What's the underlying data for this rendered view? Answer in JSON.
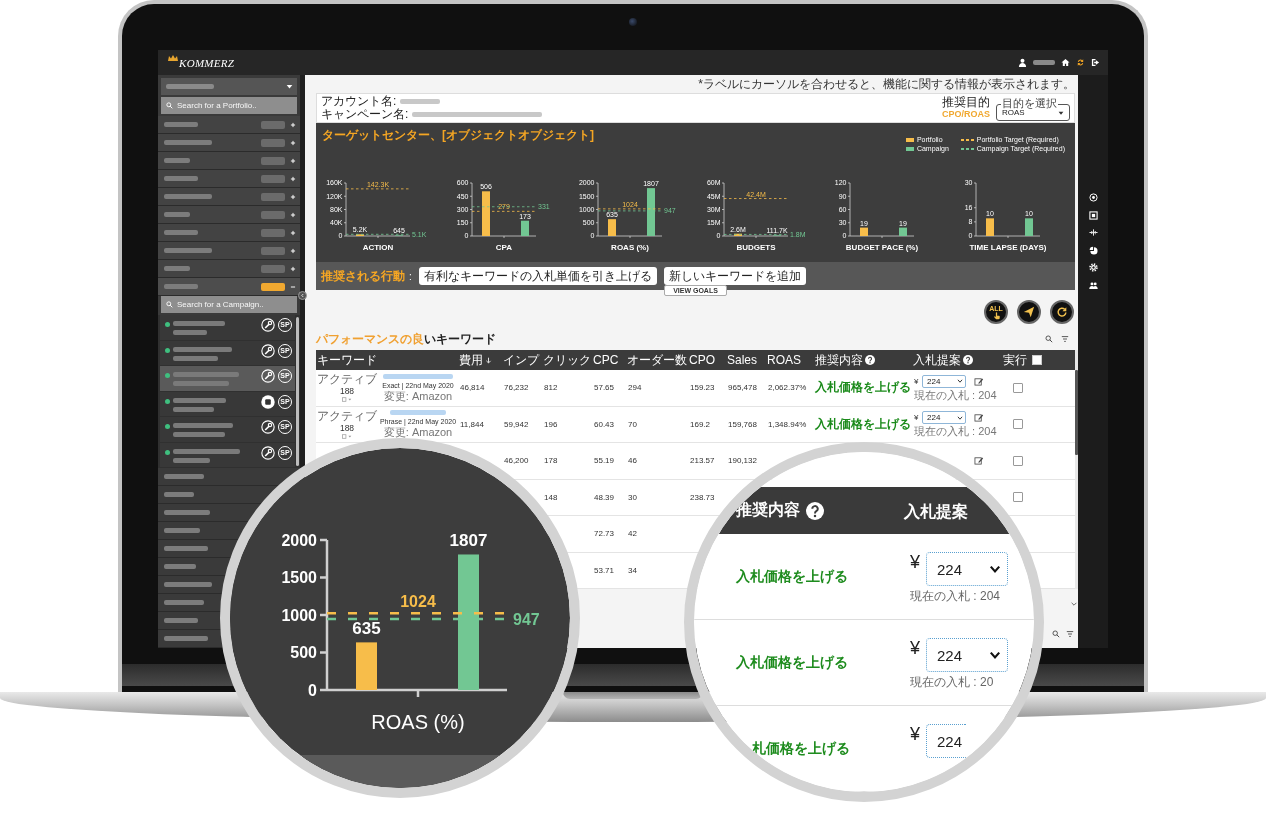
{
  "topbar": {
    "logo": "KOMMERZ"
  },
  "sidebar": {
    "portfolio_search": {
      "placeholder": "Search for a Portfolio.."
    },
    "portfolios": [
      {
        "expanded": false
      },
      {
        "expanded": false
      },
      {
        "expanded": false
      },
      {
        "expanded": false
      },
      {
        "expanded": false
      },
      {
        "expanded": false
      },
      {
        "expanded": false
      },
      {
        "expanded": false
      },
      {
        "expanded": false
      },
      {
        "expanded": true,
        "campaign_search": {
          "placeholder": "Search for a Campaign.."
        },
        "campaigns": [
          {
            "selected": false,
            "kind": "wrench",
            "type": "SP",
            "color": "#3fbf7f"
          },
          {
            "selected": false,
            "kind": "wrench",
            "type": "SP",
            "color": "#3fbf7f"
          },
          {
            "selected": true,
            "kind": "wrench",
            "type": "SP",
            "color": "#3fbf7f"
          },
          {
            "selected": false,
            "kind": "disc",
            "type": "SP",
            "color": "#3fbf7f"
          },
          {
            "selected": false,
            "kind": "wrench",
            "type": "SP",
            "color": "#3fbf7f"
          },
          {
            "selected": false,
            "kind": "wrench",
            "type": "SP",
            "color": "#3fbf7f"
          }
        ]
      }
    ]
  },
  "hint": "*ラベルにカーソルを合わせると、機能に関する情報が表示されます。",
  "account": {
    "account_label": "アカウント名:",
    "campaign_label": "キャンペーン名:",
    "goal_label": "推奨目的",
    "goal_value": "CPO/ROAS",
    "goal_select": {
      "legend": "目的を選択",
      "value": "ROAS"
    }
  },
  "target_panel": {
    "title": "ターゲットセンター、[オブジェクトオブジェクト]",
    "legend": [
      {
        "label": "Portfolio",
        "kind": "bar",
        "color": "#f7bd4a"
      },
      {
        "label": "Campaign",
        "kind": "bar",
        "color": "#72c793"
      },
      {
        "label": "Portfolio Target (Required)",
        "kind": "dash",
        "color": "#f7bd4a"
      },
      {
        "label": "Campaign Target (Required)",
        "kind": "dash",
        "color": "#72c793"
      }
    ],
    "charts": [
      {
        "chart_data": {
          "type": "bar",
          "xlabel": "ACTION",
          "series": [
            {
              "color": "#f7bd4a",
              "values": [
                5200
              ]
            },
            {
              "color": "#72c793",
              "values": [
                645
              ]
            }
          ],
          "ylim": [
            0,
            160000
          ],
          "yticks": [
            {
              "value": 0,
              "label": "0"
            },
            {
              "value": 40000,
              "label": "40K"
            },
            {
              "value": 80000,
              "label": "80K"
            },
            {
              "value": 120000,
              "label": "120K"
            },
            {
              "value": 160000,
              "label": "160K"
            }
          ],
          "value_labels": [
            "5.2K",
            "645"
          ],
          "ref_lines": [
            {
              "axis": "y",
              "value": 142300,
              "label": "142.3K",
              "color": "#f7bd4a"
            },
            {
              "axis": "y",
              "value": 5100,
              "label": "5.1K",
              "color": "#72c793"
            }
          ]
        }
      },
      {
        "chart_data": {
          "type": "bar",
          "xlabel": "CPA",
          "series": [
            {
              "color": "#f7bd4a",
              "values": [
                506
              ]
            },
            {
              "color": "#72c793",
              "values": [
                173
              ]
            }
          ],
          "ylim": [
            0,
            600
          ],
          "yticks": [
            0,
            150,
            300,
            450,
            600
          ],
          "value_labels": [
            "506",
            "173"
          ],
          "ref_lines": [
            {
              "axis": "y",
              "value": 279,
              "label": "279",
              "color": "#f7bd4a"
            },
            {
              "axis": "y",
              "value": 331,
              "label": "331",
              "color": "#72c793"
            }
          ]
        }
      },
      {
        "chart_data": {
          "type": "bar",
          "xlabel": "ROAS (%)",
          "series": [
            {
              "color": "#f7bd4a",
              "values": [
                635
              ]
            },
            {
              "color": "#72c793",
              "values": [
                1807
              ]
            }
          ],
          "ylim": [
            0,
            2000
          ],
          "yticks": [
            0,
            500,
            1000,
            1500,
            2000
          ],
          "value_labels": [
            "635",
            "1807"
          ],
          "ref_lines": [
            {
              "axis": "y",
              "value": 1024,
              "label": "1024",
              "color": "#f7bd4a"
            },
            {
              "axis": "y",
              "value": 947,
              "label": "947",
              "color": "#72c793"
            }
          ]
        }
      },
      {
        "chart_data": {
          "type": "bar",
          "xlabel": "BUDGETS",
          "series": [
            {
              "color": "#f7bd4a",
              "values": [
                2600000
              ]
            },
            {
              "color": "#72c793",
              "values": [
                111700
              ]
            }
          ],
          "ylim": [
            0,
            60000000
          ],
          "yticks": [
            {
              "value": 0,
              "label": "0"
            },
            {
              "value": 15000000,
              "label": "15M"
            },
            {
              "value": 30000000,
              "label": "30M"
            },
            {
              "value": 45000000,
              "label": "45M"
            },
            {
              "value": 60000000,
              "label": "60M"
            }
          ],
          "value_labels": [
            "2.6M",
            "111.7K"
          ],
          "ref_lines": [
            {
              "axis": "y",
              "value": 42400000,
              "label": "42.4M",
              "color": "#f7bd4a"
            },
            {
              "axis": "y",
              "value": 1800000,
              "label": "1.8M",
              "color": "#72c793"
            }
          ]
        }
      },
      {
        "chart_data": {
          "type": "bar",
          "xlabel": "BUDGET PACE (%)",
          "series": [
            {
              "color": "#f7bd4a",
              "values": [
                19
              ]
            },
            {
              "color": "#72c793",
              "values": [
                19
              ]
            }
          ],
          "ylim": [
            0,
            120
          ],
          "yticks": [
            0,
            30,
            60,
            90,
            120
          ],
          "value_labels": [
            "19",
            "19"
          ]
        }
      },
      {
        "chart_data": {
          "type": "bar",
          "xlabel": "TIME LAPSE (DAYS)",
          "series": [
            {
              "color": "#f7bd4a",
              "values": [
                10
              ]
            },
            {
              "color": "#72c793",
              "values": [
                10
              ]
            }
          ],
          "ylim": [
            0,
            30
          ],
          "yticks": [
            0,
            8,
            16,
            30
          ],
          "value_labels": [
            "10",
            "10"
          ]
        }
      }
    ],
    "actions_label": "推奨される行動",
    "actions_separator": ":",
    "actions": [
      "有利なキーワードの入札単価を引き上げる",
      "新しいキーワードを追加"
    ],
    "view_goals": "VIEW GOALS"
  },
  "toolbar": {
    "all_label": "ALL"
  },
  "keywords": {
    "title": [
      {
        "text": "パフォーマンスの良",
        "highlight": true
      },
      {
        "text": "いキーワード",
        "highlight": false
      }
    ],
    "columns": [
      {
        "label": "キーワード",
        "kind": "text"
      },
      {
        "label": "費用",
        "kind": "text",
        "sorted": true
      },
      {
        "label": "インプ",
        "kind": "text"
      },
      {
        "label": "クリック",
        "kind": "text"
      },
      {
        "label": "CPC",
        "kind": "text"
      },
      {
        "label": "オーダー数",
        "kind": "text"
      },
      {
        "label": "CPO",
        "kind": "text"
      },
      {
        "label": "Sales",
        "kind": "text"
      },
      {
        "label": "ROAS",
        "kind": "text"
      },
      {
        "label": "推奨内容",
        "kind": "text",
        "help": true
      },
      {
        "label": "入札提案",
        "kind": "text",
        "help": true
      },
      {
        "label": "実行",
        "kind": "checkbox",
        "checked": false
      }
    ],
    "rows": [
      {
        "status": "アクティブ",
        "count": "188",
        "match": "Exact | 22nd May 2020",
        "changed": "変更: Amazon",
        "cost": "46,814",
        "impressions": "76,232",
        "clicks": "812",
        "cpc": "57.65",
        "orders": "294",
        "cpo": "159.23",
        "sales": "965,478",
        "roas": "2,062.37%",
        "recommendation": "入札価格を上げる",
        "bid": {
          "currency": "¥",
          "value": "224",
          "current": "現在の入札 : 204"
        },
        "editable": true,
        "checked": false
      },
      {
        "status": "アクティブ",
        "count": "188",
        "match": "Phrase | 22nd May 2020",
        "changed": "変更: Amazon",
        "cost": "11,844",
        "impressions": "59,942",
        "clicks": "196",
        "cpc": "60.43",
        "orders": "70",
        "cpo": "169.2",
        "sales": "159,768",
        "roas": "1,348.94%",
        "recommendation": "入札価格を上げる",
        "bid": {
          "currency": "¥",
          "value": "224",
          "current": "現在の入札 : 204"
        },
        "editable": true,
        "checked": false
      },
      {
        "impressions": "46,200",
        "clicks": "178",
        "cpc": "55.19",
        "orders": "46",
        "cpo": "213.57",
        "sales": "190,132",
        "editable": true,
        "checked": false
      },
      {
        "clicks": "148",
        "cpc": "48.39",
        "orders": "30",
        "cpo": "238.73",
        "checked": false
      },
      {
        "cpc": "72.73",
        "orders": "42"
      },
      {
        "cpc": "53.71",
        "orders": "34"
      }
    ]
  },
  "roas_magnifier": {
    "chart_data": {
      "type": "bar",
      "xlabel": "ROAS (%)",
      "series": [
        {
          "color": "#f7bd4a",
          "values": [
            635
          ]
        },
        {
          "color": "#72c793",
          "values": [
            1807
          ]
        }
      ],
      "ylim": [
        0,
        2000
      ],
      "yticks": [
        0,
        500,
        1000,
        1500,
        2000
      ],
      "value_labels": [
        "635",
        "1807"
      ],
      "ref_lines": [
        {
          "axis": "y",
          "value": 1024,
          "label": "1024",
          "color": "#f7bd4a"
        },
        {
          "axis": "y",
          "value": 947,
          "label": "947",
          "color": "#72c793"
        }
      ]
    }
  },
  "bid_magnifier": {
    "columns": [
      {
        "label": "推奨内容",
        "help": true
      },
      {
        "label": "入札提案"
      }
    ],
    "rows": [
      {
        "recommendation": "入札価格を上げる",
        "currency": "¥",
        "value": "224",
        "current": "現在の入札 : 204",
        "cut": false
      },
      {
        "recommendation": "入札価格を上げる",
        "currency": "¥",
        "value": "224",
        "current": "現在の入札 : 20",
        "cut": false
      },
      {
        "recommendation": "札価格を上げる",
        "currency": "¥",
        "value": "224",
        "cut": true
      }
    ]
  }
}
